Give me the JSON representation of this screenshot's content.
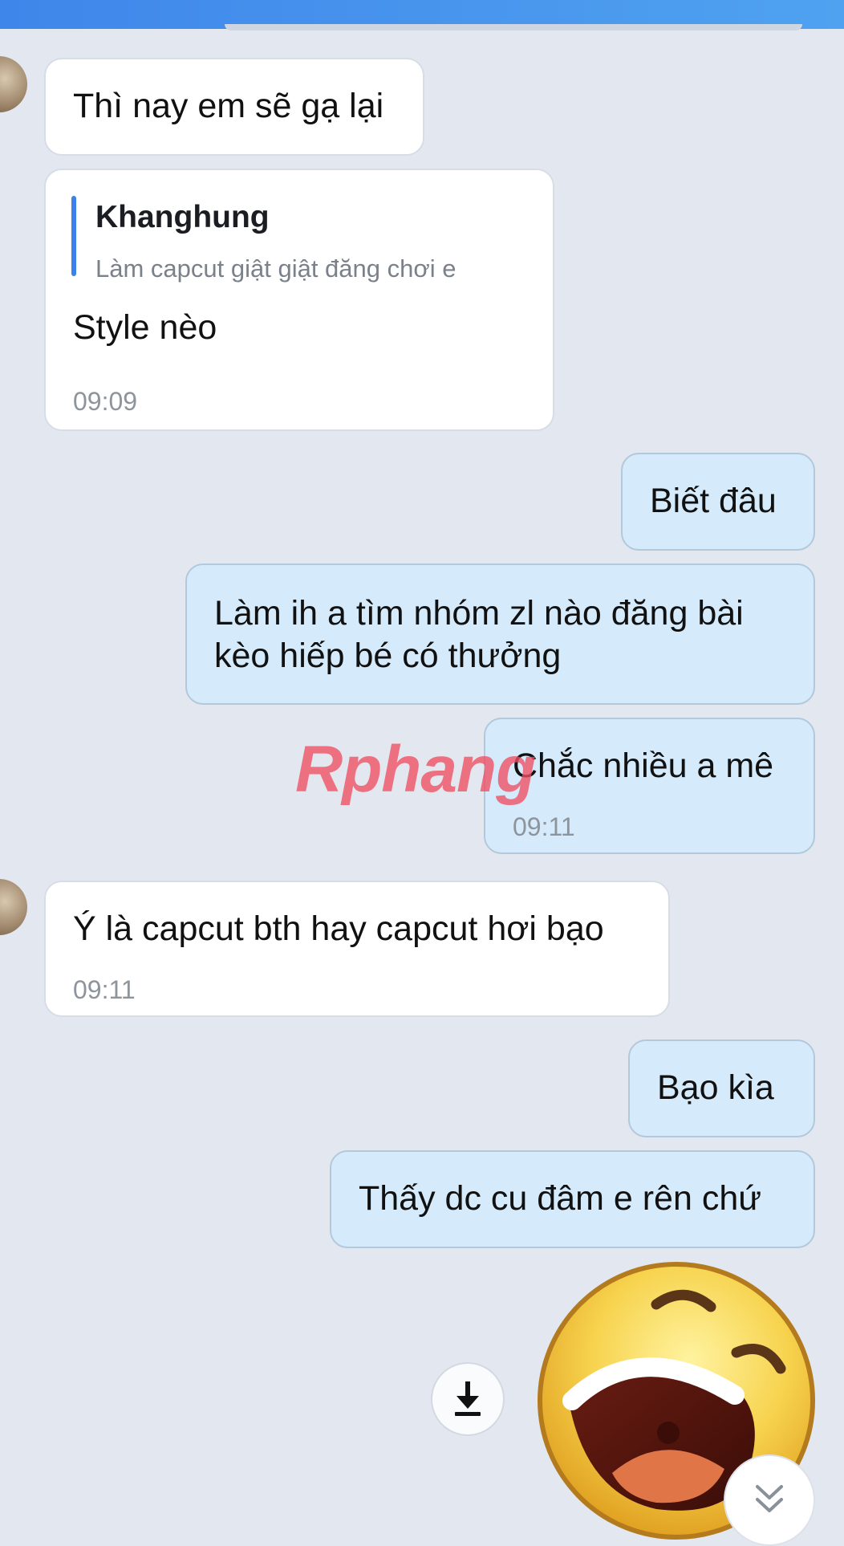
{
  "messages": [
    {
      "side": "received",
      "text": "Thì nay em sẽ gạ lại"
    },
    {
      "side": "received",
      "quote_author": "Khanghung",
      "quote_text": "Làm capcut giật giật đăng chơi e",
      "text": "Style nèo",
      "time": "09:09"
    },
    {
      "side": "sent",
      "text": "Biết đâu"
    },
    {
      "side": "sent",
      "text": "Làm ih a tìm nhóm zl nào đăng bài\nkèo hiếp bé có thưởng"
    },
    {
      "side": "sent",
      "text": "Chắc nhiều a mê",
      "time": "09:11"
    },
    {
      "side": "received",
      "text": "Ý là capcut bth hay capcut hơi bạo",
      "time": "09:11"
    },
    {
      "side": "sent",
      "text": "Bạo kìa"
    },
    {
      "side": "sent",
      "text": "Thấy dc cu đâm e rên chứ"
    }
  ],
  "watermark": "Rphang",
  "sticker": {
    "icon": "laughing-face-sticker"
  },
  "controls": {
    "download_icon": "download-icon",
    "scroll_icon": "chevron-double-down-icon"
  },
  "colors": {
    "header": "#4390ec",
    "background": "#e3e7ef",
    "sent_bubble": "#d5ebfb",
    "received_bubble": "#ffffff",
    "quote_bar": "#3b82ea"
  }
}
